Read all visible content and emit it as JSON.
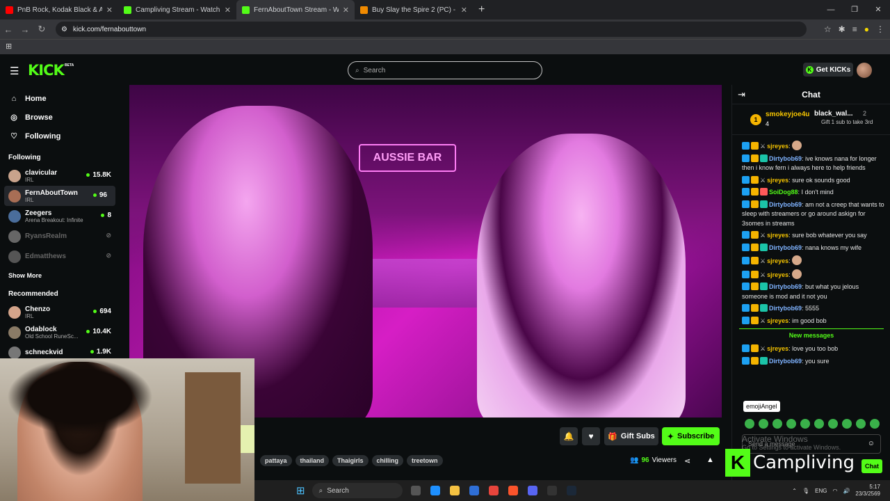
{
  "browser": {
    "tabs": [
      {
        "title": "PnB Rock, Kodak Black & A Boo",
        "color": "#ff0000"
      },
      {
        "title": "Campliving Stream - Watch Live",
        "color": "#53fc18"
      },
      {
        "title": "FernAboutTown Stream - W",
        "color": "#53fc18"
      },
      {
        "title": "Buy Slay the Spire 2 (PC) - Stea",
        "color": "#f08a00"
      }
    ],
    "url": "kick.com/fernabouttown"
  },
  "header": {
    "logo": "KICK",
    "beta": "BETA",
    "search_placeholder": "Search",
    "get_kicks": "Get KICKs"
  },
  "sidebar": {
    "nav": [
      {
        "label": "Home",
        "icon": "home-icon"
      },
      {
        "label": "Browse",
        "icon": "compass-icon"
      },
      {
        "label": "Following",
        "icon": "heart-icon"
      }
    ],
    "following_heading": "Following",
    "following": [
      {
        "name": "clavicular",
        "category": "IRL",
        "viewers": "15.8K",
        "live": true,
        "color": "#c9a38c"
      },
      {
        "name": "FernAboutTown",
        "category": "IRL",
        "viewers": "96",
        "live": true,
        "color": "#a86e55"
      },
      {
        "name": "Zeegers",
        "category": "Arena Breakout: Infinite",
        "viewers": "8",
        "live": true,
        "color": "#4a6d9b"
      },
      {
        "name": "RyansRealm",
        "category": "",
        "viewers": "",
        "live": false,
        "color": "#666"
      },
      {
        "name": "Edmatthews",
        "category": "",
        "viewers": "",
        "live": false,
        "color": "#555"
      }
    ],
    "show_more": "Show More",
    "recommended_heading": "Recommended",
    "recommended": [
      {
        "name": "Chenzo",
        "category": "IRL",
        "viewers": "694",
        "color": "#d4a48a"
      },
      {
        "name": "Odablock",
        "category": "Old School RuneSc...",
        "viewers": "10.4K",
        "color": "#8a7b66"
      },
      {
        "name": "schneckvid",
        "category": "",
        "viewers": "1.9K",
        "color": "#777"
      }
    ]
  },
  "video": {
    "neon_sign": "AUSSIE BAR"
  },
  "stream_bar": {
    "gift_subs": "Gift Subs",
    "subscribe": "Subscribe",
    "tags": [
      "pattaya",
      "thailand",
      "Thaigirls",
      "chilling",
      "treetown"
    ],
    "viewers_count": "96",
    "viewers_label": "Viewers"
  },
  "chat": {
    "title": "Chat",
    "pinned": {
      "first_user": "smokeyjoe4u",
      "first_count": "4",
      "rank": "1",
      "second_user": "black_wal...",
      "second_count": "2",
      "second_desc": "Gift 1 sub to take 3rd"
    },
    "messages": [
      {
        "user": "sjreyes",
        "type": "sj",
        "text": "",
        "emote": true
      },
      {
        "user": "Dirtybob69",
        "type": "db",
        "text": ": ive knows nana for longer then i know fern i always here to help friends"
      },
      {
        "user": "sjreyes",
        "type": "sj",
        "text": ": sure ok sounds good"
      },
      {
        "user": "SoiDog88",
        "type": "sd",
        "text": ": I don't mind"
      },
      {
        "user": "Dirtybob69",
        "type": "db",
        "text": ": am not a creep that wants to sleep with streamers or go around askign for 3somes in streams"
      },
      {
        "user": "sjreyes",
        "type": "sj",
        "text": ": sure bob whatever you say"
      },
      {
        "user": "Dirtybob69",
        "type": "db",
        "text": ": nana knows my wife"
      },
      {
        "user": "sjreyes",
        "type": "sj",
        "text": "",
        "emote": true
      },
      {
        "user": "sjreyes",
        "type": "sj",
        "text": "",
        "emote": true
      },
      {
        "user": "Dirtybob69",
        "type": "db",
        "text": ": but what you jelous someone is mod and it not you"
      },
      {
        "user": "Dirtybob69",
        "type": "db",
        "text": ": 5555"
      },
      {
        "user": "sjreyes",
        "type": "sj",
        "text": ": im good bob"
      }
    ],
    "new_messages": "New messages",
    "after_new": [
      {
        "user": "sjreyes",
        "type": "sj",
        "text": ": love you too bob"
      },
      {
        "user": "Dirtybob69",
        "type": "db",
        "text": ": you sure"
      }
    ],
    "tooltip": "emojiAngel",
    "input_placeholder": "Send a message",
    "send_label": "Chat",
    "activate_title": "Activate Windows",
    "activate_sub": "Go to Settings to activate Windows."
  },
  "watermark": "Campliving",
  "taskbar": {
    "search": "Search",
    "lang": "ENG",
    "time": "5:17",
    "date": "23/3/2569"
  }
}
